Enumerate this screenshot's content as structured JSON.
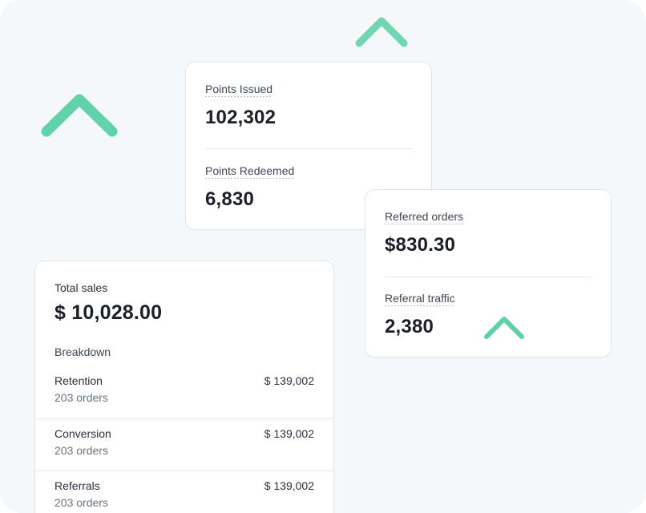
{
  "colors": {
    "accent": "#5fd1a8",
    "background": "#f5f8fa"
  },
  "icons": [
    "arrow-up-icon"
  ],
  "points_card": {
    "issued_label": "Points Issued",
    "issued_value": "102,302",
    "redeemed_label": "Points Redeemed",
    "redeemed_value": "6,830"
  },
  "referrals_card": {
    "orders_label": "Referred orders",
    "orders_value": "$830.30",
    "traffic_label": "Referral traffic",
    "traffic_value": "2,380"
  },
  "sales_card": {
    "title": "Total sales",
    "total": "$ 10,028.00",
    "breakdown_label": "Breakdown",
    "rows": [
      {
        "name": "Retention",
        "orders": "203 orders",
        "amount": "$ 139,002"
      },
      {
        "name": "Conversion",
        "orders": "203 orders",
        "amount": "$ 139,002"
      },
      {
        "name": "Referrals",
        "orders": "203 orders",
        "amount": "$ 139,002"
      }
    ]
  }
}
